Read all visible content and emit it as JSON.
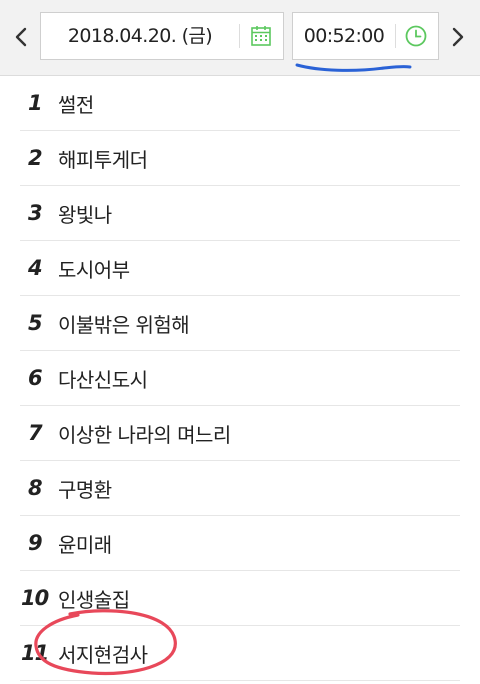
{
  "header": {
    "prev_icon": "chevron-left-icon",
    "next_icon": "chevron-right-icon",
    "date_value": "2018.04.20. (금)",
    "date_icon": "calendar-icon",
    "time_value": "00:52:00",
    "time_icon": "clock-icon"
  },
  "colors": {
    "icon_green": "#5cc85f",
    "annotation_blue": "#2a62d6",
    "annotation_red": "#e8485a"
  },
  "list": {
    "items": [
      {
        "rank": "1",
        "title": "썰전"
      },
      {
        "rank": "2",
        "title": "해피투게더"
      },
      {
        "rank": "3",
        "title": "왕빛나"
      },
      {
        "rank": "4",
        "title": "도시어부"
      },
      {
        "rank": "5",
        "title": "이불밖은 위험해"
      },
      {
        "rank": "6",
        "title": "다산신도시"
      },
      {
        "rank": "7",
        "title": "이상한 나라의 며느리"
      },
      {
        "rank": "8",
        "title": "구명환"
      },
      {
        "rank": "9",
        "title": "윤미래"
      },
      {
        "rank": "10",
        "title": "인생술집"
      },
      {
        "rank": "11",
        "title": "서지현검사"
      }
    ]
  }
}
